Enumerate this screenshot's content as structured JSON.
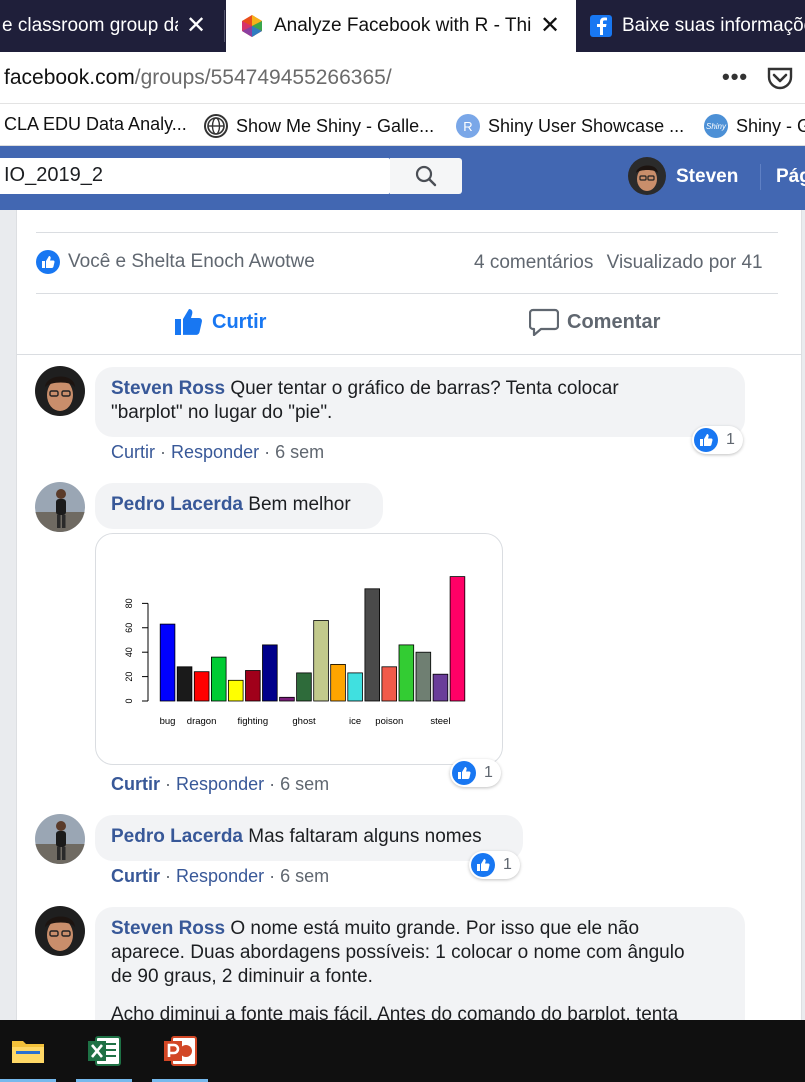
{
  "browser": {
    "tabs": [
      {
        "title": "e classroom group da"
      },
      {
        "title": "Analyze Facebook with R - Thin"
      },
      {
        "title": "Baixe suas informaçõe"
      }
    ],
    "url_host": "facebook.com",
    "url_path": "/groups/554749455266365/",
    "bookmarks": [
      {
        "label": "CLA EDU Data Analy..."
      },
      {
        "label": "Show Me Shiny - Galle..."
      },
      {
        "label": "Shiny User Showcase ..."
      },
      {
        "label": "Shiny - G"
      }
    ],
    "bookmark_r_glyph": "R",
    "bookmark_shiny_glyph": "Shiny"
  },
  "header": {
    "search_value": "IO_2019_2",
    "user_name": "Steven",
    "page_link": "Pág"
  },
  "post": {
    "reactors": "Você e Shelta Enoch Awotwe",
    "comments_count": "4 comentários",
    "seen_by": "Visualizado por 41",
    "like_label": "Curtir",
    "comment_label": "Comentar"
  },
  "comments": [
    {
      "author": "Steven Ross",
      "text_line1": "Quer tentar o gráfico de barras? Tenta colocar",
      "text_line2": "\"barplot\" no lugar do \"pie\".",
      "like": "Curtir",
      "reply": "Responder",
      "sep": "·",
      "time": "6 sem",
      "reactions": "1"
    },
    {
      "author": "Pedro Lacerda",
      "text": "Bem melhor",
      "like": "Curtir",
      "reply": "Responder",
      "sep": "·",
      "time": "6 sem",
      "reactions": "1"
    },
    {
      "author": "Pedro Lacerda",
      "text": "Mas faltaram alguns nomes",
      "like": "Curtir",
      "reply": "Responder",
      "sep": "·",
      "time": "6 sem",
      "reactions": "1"
    },
    {
      "author": "Steven Ross",
      "text_line1": "O nome está muito grande. Por isso que ele não",
      "text_line2": "aparece. Duas abordagens possíveis: 1 colocar o nome com ângulo",
      "text_line3": "de 90 graus, 2 diminuir a fonte.",
      "text_line4": "Acho diminui a fonte mais fácil. Antes do comando do barplot, tenta"
    }
  ],
  "chart_data": {
    "type": "bar",
    "title": "",
    "xlabel": "",
    "ylabel": "",
    "ylim": [
      0,
      100
    ],
    "yticks": [
      0,
      20,
      40,
      60,
      80
    ],
    "grid": false,
    "tick_labels": [
      "bug",
      "dragon",
      "fighting",
      "ghost",
      "ice",
      "poison",
      "steel"
    ],
    "values": [
      63,
      28,
      24,
      36,
      17,
      25,
      46,
      3,
      23,
      66,
      30,
      23,
      92,
      28,
      46,
      40,
      22,
      102
    ],
    "colors": [
      "#0000ff",
      "#1a1a1a",
      "#ff0000",
      "#00cc33",
      "#ffff00",
      "#a0001a",
      "#00008b",
      "#7a1d7a",
      "#2e6b3a",
      "#c2c98c",
      "#ffa500",
      "#40e0e0",
      "#4a4a4a",
      "#f15a4a",
      "#33cc33",
      "#6f7f72",
      "#6a3d9a",
      "#ff0066"
    ],
    "label_positions": [
      0,
      2,
      5,
      8,
      11,
      13,
      16
    ]
  },
  "taskbar": {
    "apps": [
      "file-explorer",
      "excel",
      "powerpoint"
    ]
  }
}
